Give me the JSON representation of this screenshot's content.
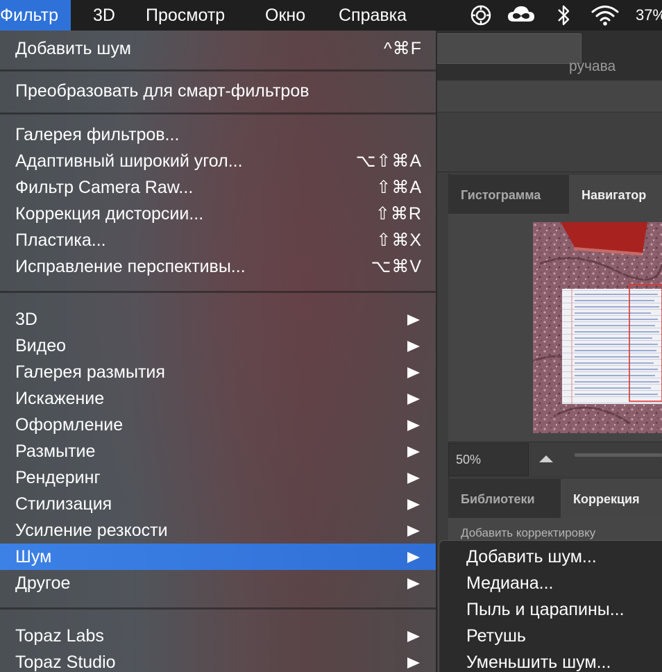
{
  "menubar": {
    "items": [
      "Фильтр",
      "3D",
      "Просмотр",
      "Окно",
      "Справка"
    ],
    "battery": "37%"
  },
  "filter_menu": {
    "last_filter": {
      "label": "Добавить шум",
      "shortcut": "^⌘F"
    },
    "convert_smart": {
      "label": "Преобразовать для смарт-фильтров"
    },
    "group2": [
      {
        "label": "Галерея фильтров...",
        "shortcut": ""
      },
      {
        "label": "Адаптивный широкий угол...",
        "shortcut": "⌥⇧⌘A"
      },
      {
        "label": "Фильтр Camera Raw...",
        "shortcut": "⇧⌘A"
      },
      {
        "label": "Коррекция дисторсии...",
        "shortcut": "⇧⌘R"
      },
      {
        "label": "Пластика...",
        "shortcut": "⇧⌘X"
      },
      {
        "label": "Исправление перспективы...",
        "shortcut": "⌥⌘V"
      }
    ],
    "submenus": [
      "3D",
      "Видео",
      "Галерея размытия",
      "Искажение",
      "Оформление",
      "Размытие",
      "Рендеринг",
      "Стилизация",
      "Усиление резкости",
      "Шум",
      "Другое"
    ],
    "highlighted": "Шум",
    "plugins": [
      "Topaz Labs",
      "Topaz Studio"
    ]
  },
  "noise_submenu": {
    "items": [
      "Добавить шум...",
      "Медиана...",
      "Пыль и царапины...",
      "Ретушь",
      "Уменьшить шум..."
    ]
  },
  "background": {
    "doc_tab_title": "ручава",
    "panel_tabs_top": [
      "Гистограмма",
      "Навигатор"
    ],
    "zoom_value": "50%",
    "panel_tabs_bottom": [
      "Библиотеки",
      "Коррекция"
    ],
    "adjust_hint": "Добавить корректировку"
  },
  "colors": {
    "menubar_highlight": "#2e72d9",
    "menu_highlight": "#3c81e6",
    "navigator_view_box": "#e0342e"
  }
}
